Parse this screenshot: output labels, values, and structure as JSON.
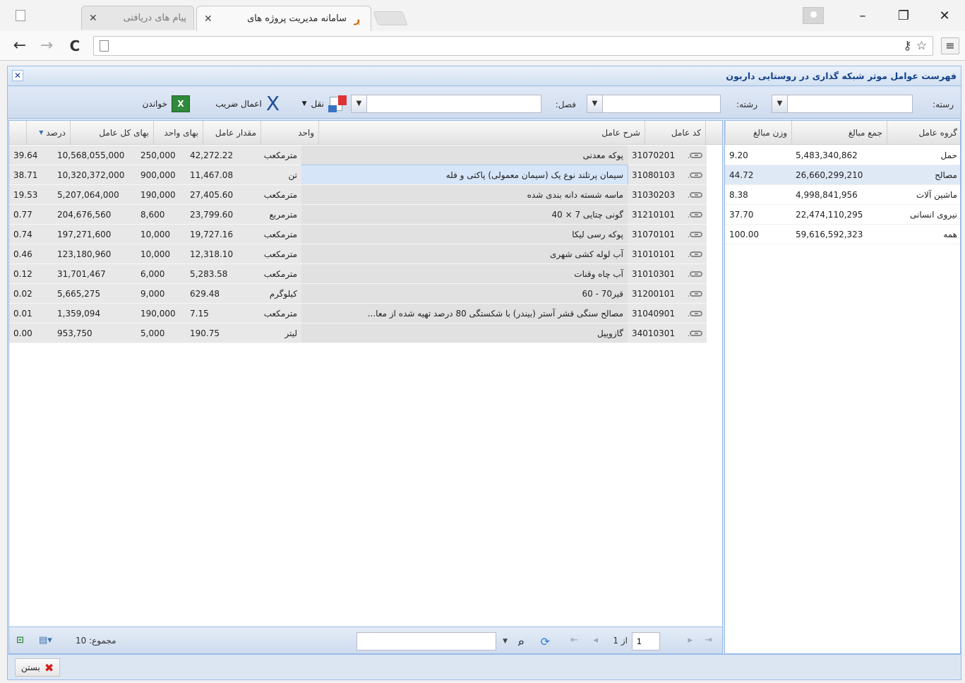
{
  "browser": {
    "tabs": [
      {
        "title": "پیام های دریافتی",
        "active": false
      },
      {
        "title": "سامانه مدیریت پروژه های",
        "active": true
      }
    ],
    "window_controls": {
      "minimize": "–",
      "restore": "❐",
      "close": "✕"
    },
    "nav": {
      "back": "←",
      "forward": "→",
      "reload": "C"
    },
    "menu_icon": "≡"
  },
  "app": {
    "title": "فهرست عوامل موثر شبکه گذاری در روستایی داربون",
    "close": "✕",
    "filters": {
      "reste_label": "رسته:",
      "reshte_label": "رشته:",
      "fasl_label": "فصل:",
      "reste_value": "",
      "reshte_value": "",
      "fasl_value": "",
      "naql_label": "نقل",
      "multiplier_label": "اعمال ضریب",
      "read_label": "خواندن"
    },
    "side_grid": {
      "columns": [
        "گروه عامل",
        "جمع مبالغ",
        "وزن مبالغ"
      ],
      "rows": [
        {
          "group": "حمل",
          "sum": "5,483,340,862",
          "weight": "9.20"
        },
        {
          "group": "مصالح",
          "sum": "26,660,299,210",
          "weight": "44.72"
        },
        {
          "group": "ماشین آلات",
          "sum": "4,998,841,956",
          "weight": "8.38"
        },
        {
          "group": "نیروی انسانی",
          "sum": "22,474,110,295",
          "weight": "37.70"
        },
        {
          "group": "همه",
          "sum": "59,616,592,323",
          "weight": "100.00"
        }
      ],
      "selected_index": 1
    },
    "main_grid": {
      "columns": [
        "کد عامل",
        "شرح عامل",
        "واحد",
        "مقدار عامل",
        "بهای واحد",
        "بهای کل عامل",
        "درصد"
      ],
      "sort_indicator": "▼",
      "rows": [
        {
          "code": "31070201",
          "desc": "پوکه معدنی",
          "unit": "مترمکعب",
          "qty": "42,272.22",
          "unit_price": "250,000",
          "total": "10,568,055,000",
          "pct": "39.64"
        },
        {
          "code": "31080103",
          "desc": "سیمان پرتلند نوع یک (سیمان معمولی) پاکتی و فله",
          "unit": "تن",
          "qty": "11,467.08",
          "unit_price": "900,000",
          "total": "10,320,372,000",
          "pct": "38.71"
        },
        {
          "code": "31030203",
          "desc": "ماسه شسته دانه بندی شده",
          "unit": "مترمکعب",
          "qty": "27,405.60",
          "unit_price": "190,000",
          "total": "5,207,064,000",
          "pct": "19.53"
        },
        {
          "code": "31210101",
          "desc": "گونی چتایی 7 × 40",
          "unit": "مترمربع",
          "qty": "23,799.60",
          "unit_price": "8,600",
          "total": "204,676,560",
          "pct": "0.77"
        },
        {
          "code": "31070101",
          "desc": "پوکه رسی لیکا",
          "unit": "مترمکعب",
          "qty": "19,727.16",
          "unit_price": "10,000",
          "total": "197,271,600",
          "pct": "0.74"
        },
        {
          "code": "31010101",
          "desc": "آب لوله کشی شهری",
          "unit": "مترمکعب",
          "qty": "12,318.10",
          "unit_price": "10,000",
          "total": "123,180,960",
          "pct": "0.46"
        },
        {
          "code": "31010301",
          "desc": "آب چاه وقنات",
          "unit": "مترمکعب",
          "qty": "5,283.58",
          "unit_price": "6,000",
          "total": "31,701,467",
          "pct": "0.12"
        },
        {
          "code": "31200101",
          "desc": "قیر70 - 60",
          "unit": "کیلوگرم",
          "qty": "629.48",
          "unit_price": "9,000",
          "total": "5,665,275",
          "pct": "0.02"
        },
        {
          "code": "31040901",
          "desc": "مصالح سنگی قشر آستر (بیندر) با شکستگی 80 درصد تهیه شده از معا...",
          "unit": "مترمکعب",
          "qty": "7.15",
          "unit_price": "190,000",
          "total": "1,359,094",
          "pct": "0.01"
        },
        {
          "code": "34010301",
          "desc": "گازوییل",
          "unit": "لیتر",
          "qty": "190.75",
          "unit_price": "5,000",
          "total": "953,750",
          "pct": "0.00"
        }
      ],
      "selected_index": 1
    },
    "pager": {
      "page_value": "1",
      "of_label": "از 1",
      "total_label": "مجموع: 10",
      "search_value": ""
    },
    "close_button": "بستن",
    "colors": {
      "accent": "#15428b",
      "border": "#99bbe8",
      "header_bg": "#dce6f2"
    }
  }
}
